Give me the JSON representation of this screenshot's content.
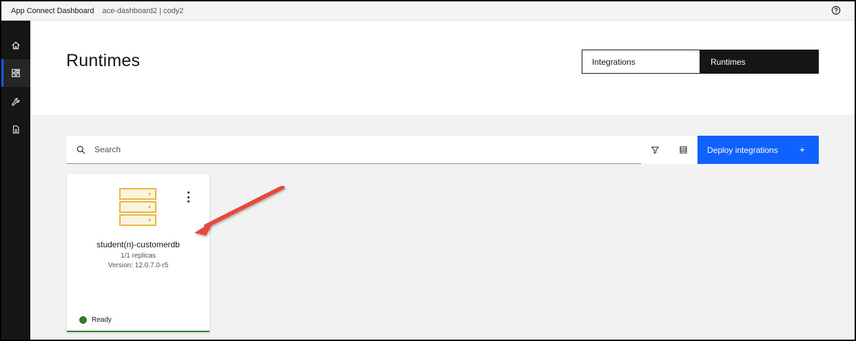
{
  "topbar": {
    "brand": "App Connect Dashboard",
    "context": "ace-dashboard2  |  cody2",
    "help_icon": "help-icon"
  },
  "sidenav": {
    "items": [
      {
        "icon": "home-icon",
        "active": false
      },
      {
        "icon": "dashboard-icon",
        "active": true
      },
      {
        "icon": "wrench-icon",
        "active": false
      },
      {
        "icon": "document-icon",
        "active": false
      }
    ]
  },
  "page": {
    "title": "Runtimes"
  },
  "switcher": {
    "integrations_label": "Integrations",
    "runtimes_label": "Runtimes"
  },
  "toolbar": {
    "search_placeholder": "Search",
    "filter_icon": "filter-icon",
    "table_icon": "table-view-icon",
    "deploy_label": "Deploy integrations",
    "deploy_plus": "+"
  },
  "card": {
    "name": "student(n)-customerdb",
    "replicas": "1/1 replicas",
    "version": "Version: 12.0.7.0-r5",
    "status": "Ready"
  },
  "colors": {
    "accent": "#0f62fe",
    "nav_bg": "#161616",
    "ready": "#2e7d32",
    "server_icon": "#e8b83c",
    "annotation_arrow": "#e8473a"
  }
}
